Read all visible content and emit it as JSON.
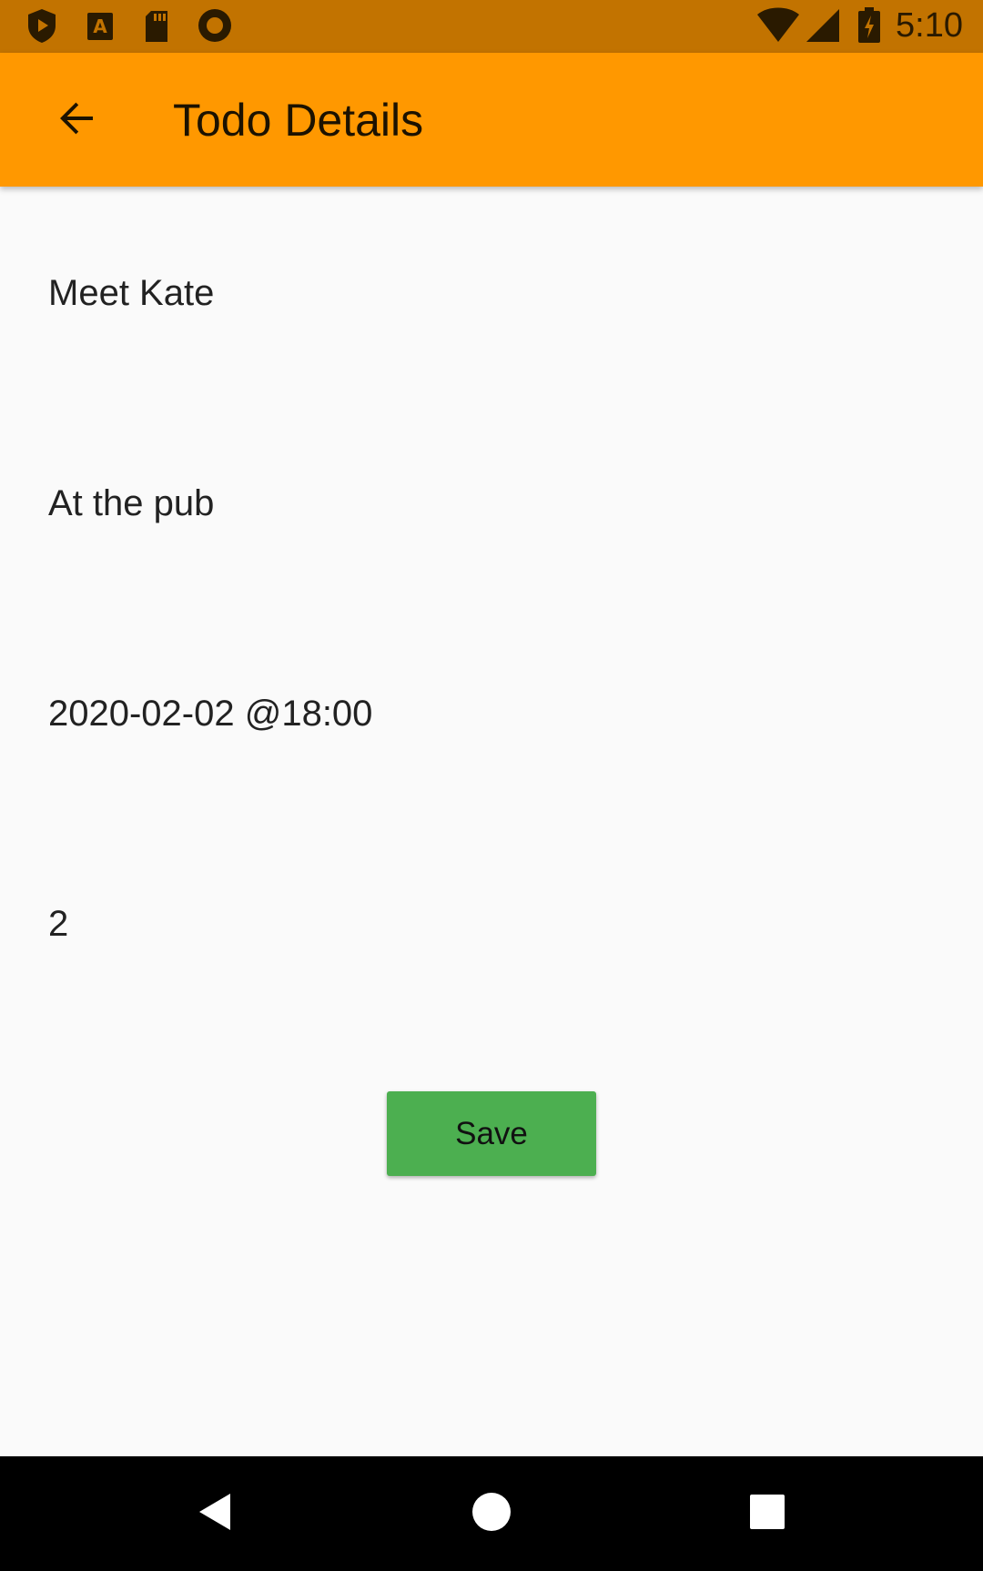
{
  "status_bar": {
    "time": "5:10",
    "left_icons": [
      "shield-play-icon",
      "text-a-icon",
      "sd-card-icon",
      "record-icon"
    ],
    "right_icons": [
      "wifi-icon",
      "cell-signal-icon",
      "battery-charging-icon"
    ]
  },
  "app_bar": {
    "title": "Todo Details",
    "back_icon": "arrow-back-icon",
    "color": "#ff9800"
  },
  "fields": {
    "title": "Meet Kate",
    "description": "At the pub",
    "datetime": "2020-02-02 @18:00",
    "priority": "2"
  },
  "save_button": {
    "label": "Save",
    "color": "#4caf50"
  },
  "nav_bar": {
    "items": [
      "back-triangle-icon",
      "home-circle-icon",
      "recents-square-icon"
    ]
  }
}
